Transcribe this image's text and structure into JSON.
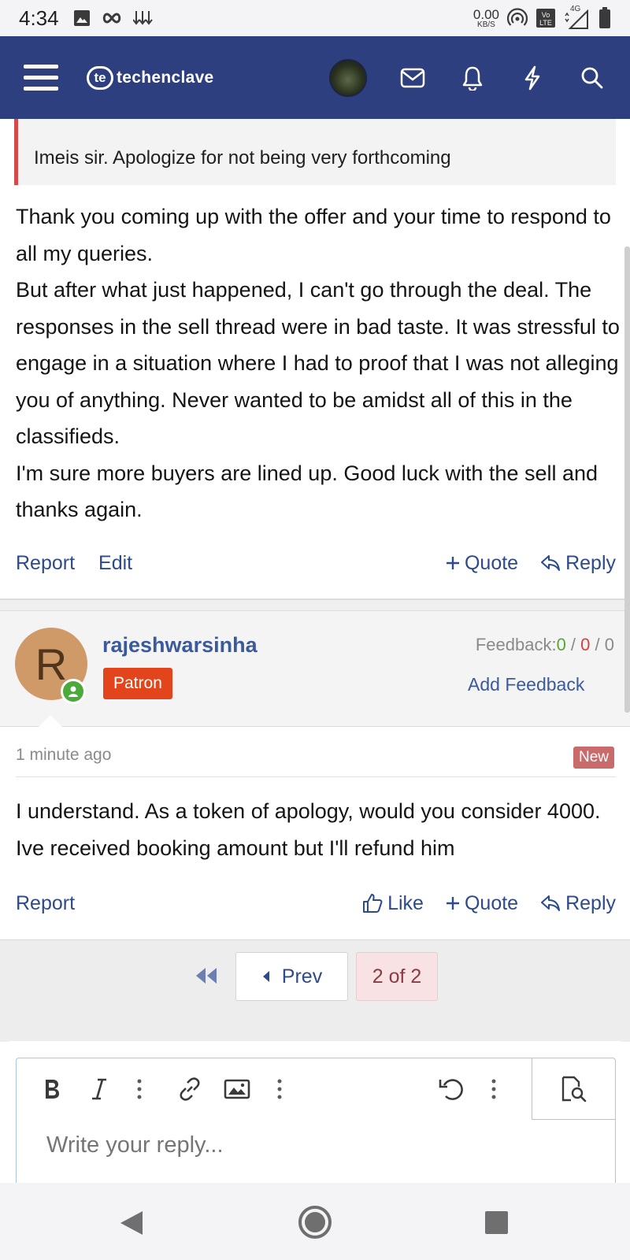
{
  "status_bar": {
    "time": "4:34",
    "net_speed": "0.00",
    "net_unit": "KB/S",
    "network_label": "4G"
  },
  "header": {
    "logo_badge": "te",
    "logo_text": "techenclave"
  },
  "quote": {
    "text": "Imeis sir. Apologize for not being very forthcoming"
  },
  "post1": {
    "paragraphs": [
      "Thank you coming up with the offer and your time to respond to all my queries.",
      "But after what just happened, I can't go through the deal. The responses in the sell thread were in bad taste. It was stressful to engage in a situation where I had to proof that I was not alleging you of anything. Never wanted to be amidst all of this in the classifieds.",
      "I'm sure more buyers are lined up. Good luck with the sell and thanks again."
    ],
    "actions": {
      "report": "Report",
      "edit": "Edit",
      "quote": "Quote",
      "reply": "Reply"
    }
  },
  "post2": {
    "author": {
      "initial": "R",
      "username": "rajeshwarsinha",
      "badge": "Patron"
    },
    "feedback": {
      "label": "Feedback:",
      "positive": "0",
      "negative": "0",
      "neutral": "0",
      "sep": " / ",
      "add_label": "Add Feedback"
    },
    "timestamp": "1 minute ago",
    "new_badge": "New",
    "text": "I understand. As a token of apology, would you consider 4000. Ive received booking amount but I'll refund him",
    "actions": {
      "report": "Report",
      "like": "Like",
      "quote": "Quote",
      "reply": "Reply"
    }
  },
  "pagination": {
    "prev_label": "Prev",
    "current": "2 of 2"
  },
  "editor": {
    "placeholder": "Write your reply..."
  },
  "colors": {
    "header_bg": "#2d3f7e",
    "link": "#2d4a8a",
    "patron_badge": "#e2451b",
    "new_badge": "#c96b6b",
    "quote_border": "#d34a4a"
  }
}
